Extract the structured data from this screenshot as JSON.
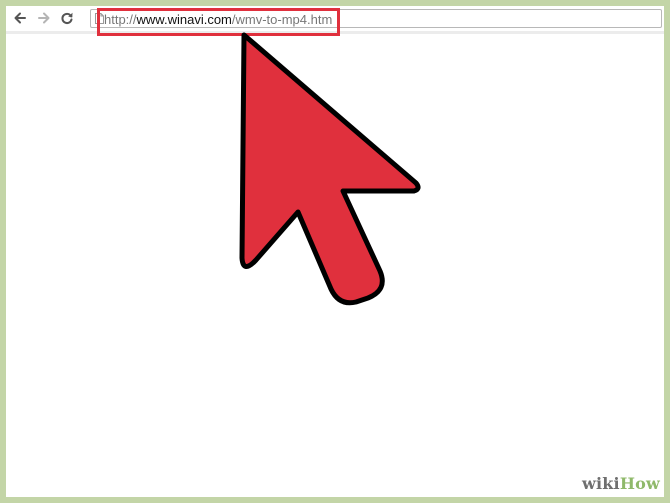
{
  "browser": {
    "back_icon": "arrow-left-icon",
    "forward_icon": "arrow-right-icon",
    "reload_icon": "reload-icon",
    "page_icon": "document-icon",
    "address": {
      "scheme": "http://",
      "host": "www.winavi.com",
      "path": "/wmv-to-mp4.htm"
    }
  },
  "annotation": {
    "highlight_color": "#e0303d",
    "cursor_fill": "#e0303d",
    "cursor_icon": "mouse-pointer-icon"
  },
  "colors": {
    "frame": "#c3d5a7",
    "watermark_gray": "#6f6f6f",
    "watermark_green": "#8fb96a"
  },
  "watermark": {
    "part1": "wiki",
    "part2": "How"
  }
}
